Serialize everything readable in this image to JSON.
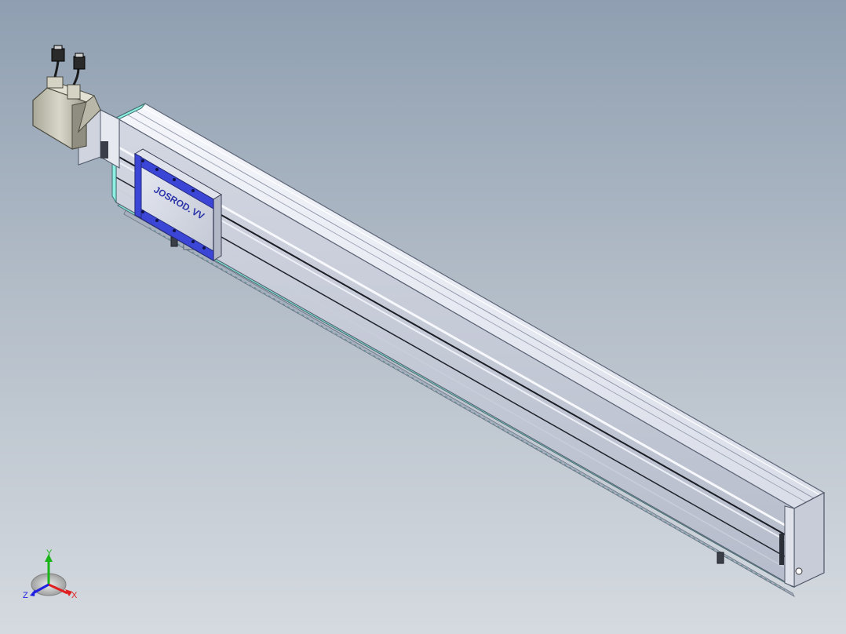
{
  "viewport": {
    "background_top": "#8f9fb1",
    "background_bottom": "#d5dae0"
  },
  "model": {
    "carriage_logo": "JOSROD.",
    "carriage_logo_prefix": "VV",
    "colors": {
      "rail_light": "#e9ecf5",
      "rail_mid": "#cfd4e0",
      "rail_dark": "#9aa1b2",
      "accent_cyan": "#6fe3d4",
      "carriage_blue": "#3a45d2",
      "motor_tan": "#c7c6b8"
    }
  },
  "triad": {
    "x_label": "X",
    "y_label": "Y",
    "z_label": "Z",
    "x_color": "#e02020",
    "y_color": "#20c020",
    "z_color": "#2020e0"
  }
}
